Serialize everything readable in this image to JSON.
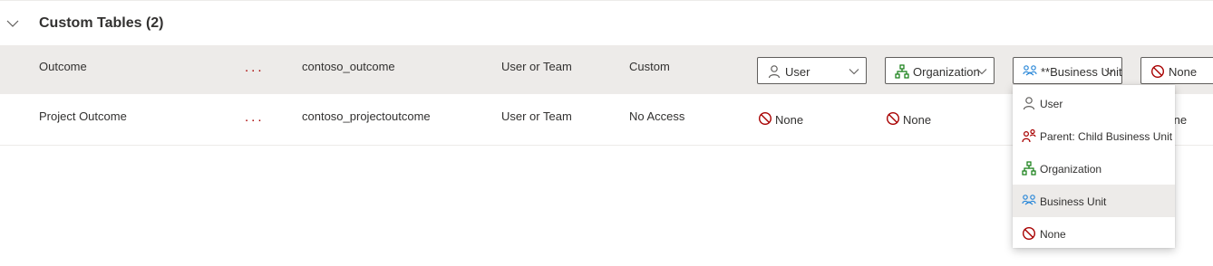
{
  "section": {
    "title": "Custom Tables (2)"
  },
  "rows": [
    {
      "name": "Outcome",
      "more": "...",
      "logical_name": "contoso_outcome",
      "ownership": "User or Team",
      "type": "Custom",
      "dropdowns": [
        {
          "label": "User",
          "icon": "user-icon"
        },
        {
          "label": "Organization",
          "icon": "organization-icon"
        },
        {
          "label": "**Business Unit",
          "icon": "business-unit-icon"
        },
        {
          "label": "None",
          "icon": "none-icon"
        }
      ]
    },
    {
      "name": "Project Outcome",
      "more": "...",
      "logical_name": "contoso_projectoutcome",
      "ownership": "User or Team",
      "type": "No Access",
      "privileges": [
        {
          "label": "None",
          "icon": "none-icon"
        },
        {
          "label": "None",
          "icon": "none-icon"
        },
        {
          "label": "None",
          "icon": "none-icon"
        }
      ]
    }
  ],
  "menu": {
    "items": [
      {
        "label": "User",
        "icon": "user-icon"
      },
      {
        "label": "Parent: Child Business Unit",
        "icon": "parent-child-business-unit-icon"
      },
      {
        "label": "Organization",
        "icon": "organization-icon"
      },
      {
        "label": "Business Unit",
        "icon": "business-unit-icon",
        "selected": true
      },
      {
        "label": "None",
        "icon": "none-icon"
      }
    ]
  },
  "colors": {
    "user": "#605e5c",
    "organization": "#107c10",
    "business_unit": "#2b88d8",
    "none": "#a80000",
    "row_selected": "#edebe9"
  }
}
